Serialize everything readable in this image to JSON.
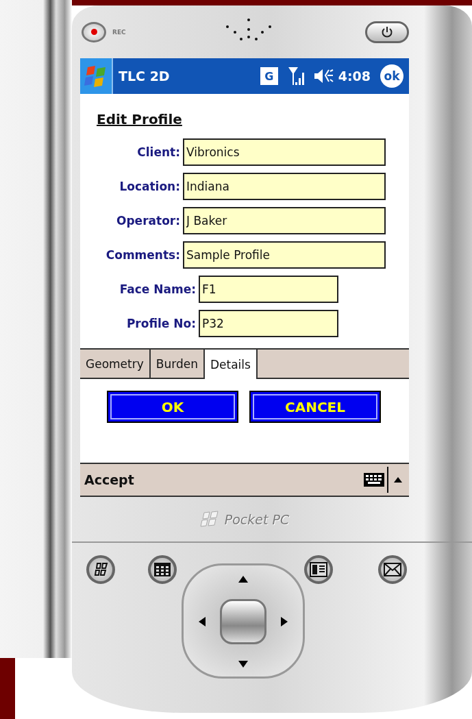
{
  "device": {
    "rec_label": "REC",
    "brand": "Pocket PC"
  },
  "title_bar": {
    "title": "TLC 2D",
    "network": "G",
    "time": "4:08",
    "ok": "ok"
  },
  "form": {
    "heading": "Edit Profile",
    "fields": [
      {
        "label": "Client:",
        "value": "Vibronics",
        "kind": "wide"
      },
      {
        "label": "Location:",
        "value": "Indiana",
        "kind": "wide"
      },
      {
        "label": "Operator:",
        "value": "J Baker",
        "kind": "wide"
      },
      {
        "label": "Comments:",
        "value": "Sample Profile",
        "kind": "wide"
      },
      {
        "label": "Face Name:",
        "value": "F1",
        "kind": "narrow"
      },
      {
        "label": "Profile No:",
        "value": "P32",
        "kind": "narrow"
      }
    ]
  },
  "tabs": [
    {
      "label": "Geometry",
      "selected": false
    },
    {
      "label": "Burden",
      "selected": false
    },
    {
      "label": "Details",
      "selected": true
    }
  ],
  "buttons": [
    "OK",
    "CANCEL"
  ],
  "menu_bar": {
    "label": "Accept"
  }
}
